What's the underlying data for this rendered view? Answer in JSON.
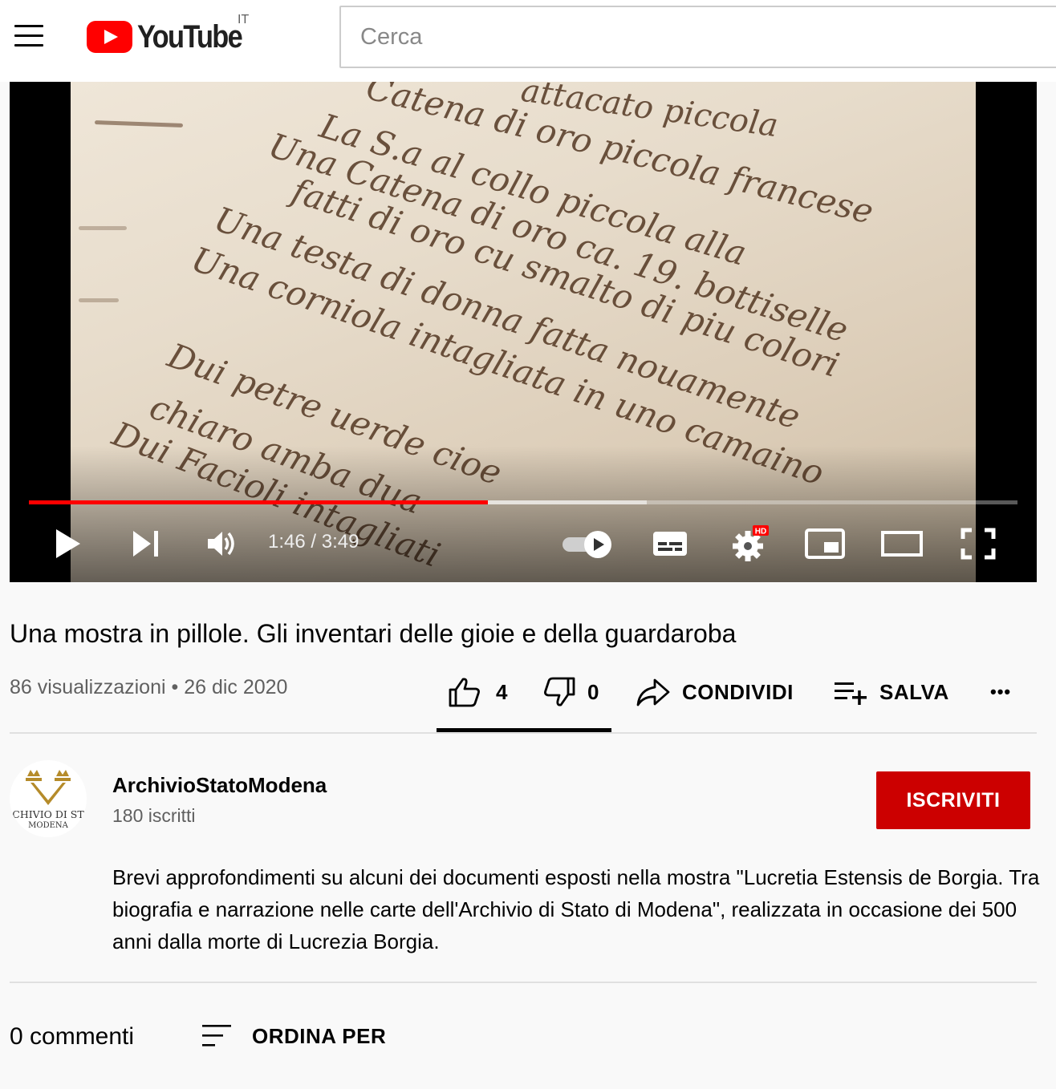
{
  "header": {
    "logo_text": "YouTube",
    "country_code": "IT",
    "search_placeholder": "Cerca"
  },
  "player": {
    "current_time": "1:46",
    "duration": "3:49",
    "time_display": "1:46 / 3:49",
    "progress_fraction": 0.464,
    "buffered_fraction": 0.625,
    "hd_badge": "HD",
    "autoplay": true,
    "icons": [
      "play-icon",
      "next-icon",
      "volume-icon",
      "autoplay-toggle",
      "subtitles-icon",
      "settings-icon",
      "miniplayer-icon",
      "theater-mode-icon",
      "fullscreen-icon"
    ],
    "manuscript_lines": [
      "attacato piccola",
      "Catena di oro piccola francese",
      "La S.a al collo piccola alla",
      "Una Catena di oro ca. 19. bottiselle",
      "fatti di oro cu smalto di piu colori",
      "Una testa di donna fatta nouamente",
      "Una corniola intagliata in uno camaino",
      "Dui petre uerde cioe",
      "chiaro amba dua",
      "Dui Facioli intagliati"
    ]
  },
  "video": {
    "title": "Una mostra in pillole. Gli inventari delle gioie e della guardaroba",
    "views_date": "86 visualizzazioni • 26 dic 2020",
    "likes": "4",
    "dislikes": "0",
    "share_label": "CONDIVIDI",
    "save_label": "SALVA",
    "more_label": "•••"
  },
  "channel": {
    "name": "ArchivioStatoModena",
    "subscribers": "180 iscritti",
    "subscribe_label": "ISCRIVITI",
    "avatar_text_line1": "CHIVIO DI ST",
    "avatar_text_line2": "MODENA",
    "description": "Brevi approfondimenti su alcuni dei documenti esposti nella mostra \"Lucretia Estensis de Borgia. Tra biografia e narrazione nelle carte dell'Archivio di Stato di Modena\", realizzata in occasione dei 500 anni dalla morte di Lucrezia Borgia."
  },
  "comments": {
    "count_label": "0 commenti",
    "sort_label": "ORDINA PER"
  },
  "colors": {
    "brand_red": "#ff0000",
    "subscribe_red": "#cc0000",
    "progress_red": "#ff0000",
    "text_primary": "#030303",
    "text_secondary": "#606060"
  }
}
